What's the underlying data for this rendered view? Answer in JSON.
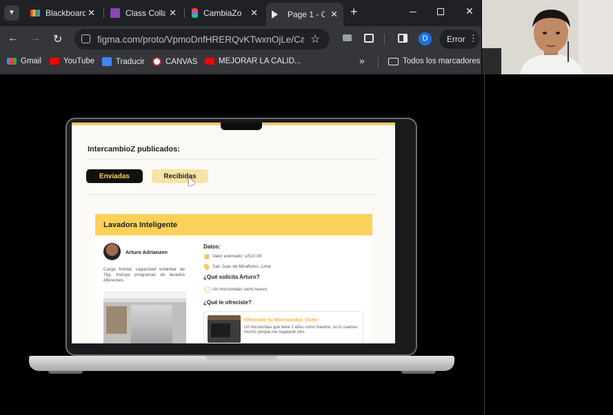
{
  "browser": {
    "tabs": [
      {
        "title": "Blackboard",
        "active": false
      },
      {
        "title": "Class Colla",
        "active": false
      },
      {
        "title": "CambiaZo",
        "active": false
      },
      {
        "title": "Page 1 - C",
        "active": true
      }
    ],
    "new_tab": "+",
    "url": "figma.com/proto/VpmoDnfHRERQvKTwxnOjLe/Cam...",
    "profile_initial": "D",
    "error_label": "Error",
    "bookmarks": [
      "Gmail",
      "YouTube",
      "Traducir",
      "CANVAS",
      "MEJORAR LA CALID..."
    ],
    "all_bookmarks": "Todos los marcadores"
  },
  "colors": {
    "accent_yellow": "#fcd15a",
    "dark_pill": "#111111",
    "light_pill": "#f8e3a6"
  },
  "app": {
    "section_title": "IntercambioZ publicados:",
    "tabs": {
      "sent": "Enviadas",
      "received": "Recibidas"
    },
    "card": {
      "product_title": "Lavadora Inteligente",
      "owner_name": "Arturo Adrianzen",
      "description": "Carga frontal, capacidad estándar de 7kg. Incluye programas de lavados diferentes.",
      "data_label": "Datos:",
      "estimated_value": "Valor estimado: s/510.00",
      "location": "San Juan de Miraflores, Lima",
      "requests_label": "¿Qué solicita Arturo?",
      "request_item": "Un microondas semi-nuevo.",
      "offered_label": "¿Qué le ofreciste?",
      "offer": {
        "title": "Ofreciste tu Microondas Oster",
        "description": "Un microondas que tiene 2 años como máximo, no lo usamos mucho porque me regalaron otro."
      }
    }
  }
}
